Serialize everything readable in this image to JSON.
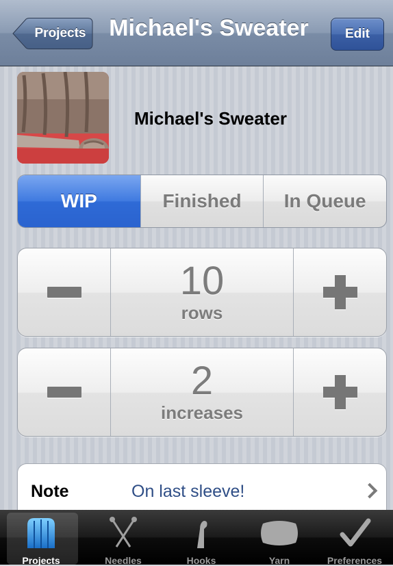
{
  "nav": {
    "back_label": "Projects",
    "title": "Michael's Sweater",
    "edit_label": "Edit"
  },
  "project": {
    "name": "Michael's Sweater"
  },
  "status_segments": {
    "selected": "WIP",
    "options": [
      "WIP",
      "Finished",
      "In Queue"
    ]
  },
  "counters": [
    {
      "value": "10",
      "unit": "rows"
    },
    {
      "value": "2",
      "unit": "increases"
    }
  ],
  "note": {
    "label": "Note",
    "value": "On last sleeve!"
  },
  "tabs": [
    {
      "label": "Projects",
      "icon": "projects-icon",
      "active": true
    },
    {
      "label": "Needles",
      "icon": "needles-icon",
      "active": false
    },
    {
      "label": "Hooks",
      "icon": "hook-icon",
      "active": false
    },
    {
      "label": "Yarn",
      "icon": "yarn-icon",
      "active": false
    },
    {
      "label": "Preferences",
      "icon": "checkmark-icon",
      "active": false
    }
  ],
  "colors": {
    "accent": "#2f6ad6",
    "navbar": "#7a8ca6",
    "note_value": "#2f4e86"
  }
}
